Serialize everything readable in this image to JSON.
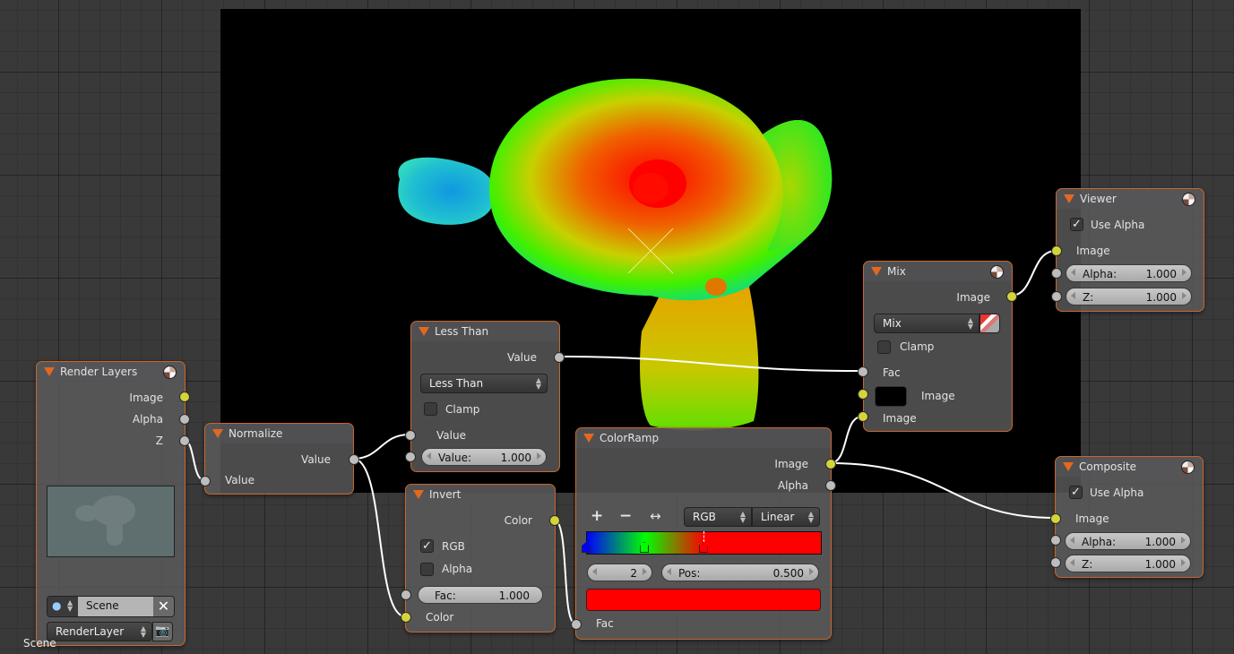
{
  "editor": {
    "scene_label": "Scene"
  },
  "nodes": {
    "render_layers": {
      "title": "Render Layers",
      "outputs": [
        "Image",
        "Alpha",
        "Z"
      ],
      "scene_field": "Scene",
      "layer_select": "RenderLayer"
    },
    "normalize": {
      "title": "Normalize",
      "output": "Value",
      "input": "Value"
    },
    "less_than": {
      "title": "Less Than",
      "output": "Value",
      "operation": "Less Than",
      "clamp_label": "Clamp",
      "clamp_checked": false,
      "input1": "Value",
      "input2_label": "Value:",
      "input2_value": "1.000"
    },
    "invert": {
      "title": "Invert",
      "output": "Color",
      "rgb_label": "RGB",
      "rgb_checked": true,
      "alpha_label": "Alpha",
      "alpha_checked": false,
      "fac_label": "Fac:",
      "fac_value": "1.000",
      "input": "Color"
    },
    "color_ramp": {
      "title": "ColorRamp",
      "outputs": [
        "Image",
        "Alpha"
      ],
      "add_icon": "+",
      "remove_icon": "−",
      "flip_icon": "↔",
      "color_mode": "RGB",
      "interpolation": "Linear",
      "stops": [
        {
          "pos": 0.0,
          "color": "#0000ff"
        },
        {
          "pos": 0.25,
          "color": "#00ff00"
        },
        {
          "pos": 0.5,
          "color": "#ff0000"
        }
      ],
      "active_index": "2",
      "pos_label": "Pos:",
      "pos_value": "0.500",
      "active_color": "#ff0000",
      "input": "Fac"
    },
    "mix": {
      "title": "Mix",
      "output": "Image",
      "blend_type": "Mix",
      "clamp_label": "Clamp",
      "clamp_checked": false,
      "inputs": [
        "Fac",
        "Image",
        "Image"
      ],
      "image1_color": "#000000"
    },
    "viewer": {
      "title": "Viewer",
      "use_alpha_label": "Use Alpha",
      "use_alpha_checked": true,
      "input_image": "Image",
      "alpha_label": "Alpha:",
      "alpha_value": "1.000",
      "z_label": "Z:",
      "z_value": "1.000"
    },
    "composite": {
      "title": "Composite",
      "use_alpha_label": "Use Alpha",
      "use_alpha_checked": true,
      "input_image": "Image",
      "alpha_label": "Alpha:",
      "alpha_value": "1.000",
      "z_label": "Z:",
      "z_value": "1.000"
    }
  },
  "colors": {
    "node_border": "#c8672a",
    "socket_color": "#d4d43a",
    "socket_value": "#bdbdbd",
    "collapse_triangle": "#e2691e"
  }
}
